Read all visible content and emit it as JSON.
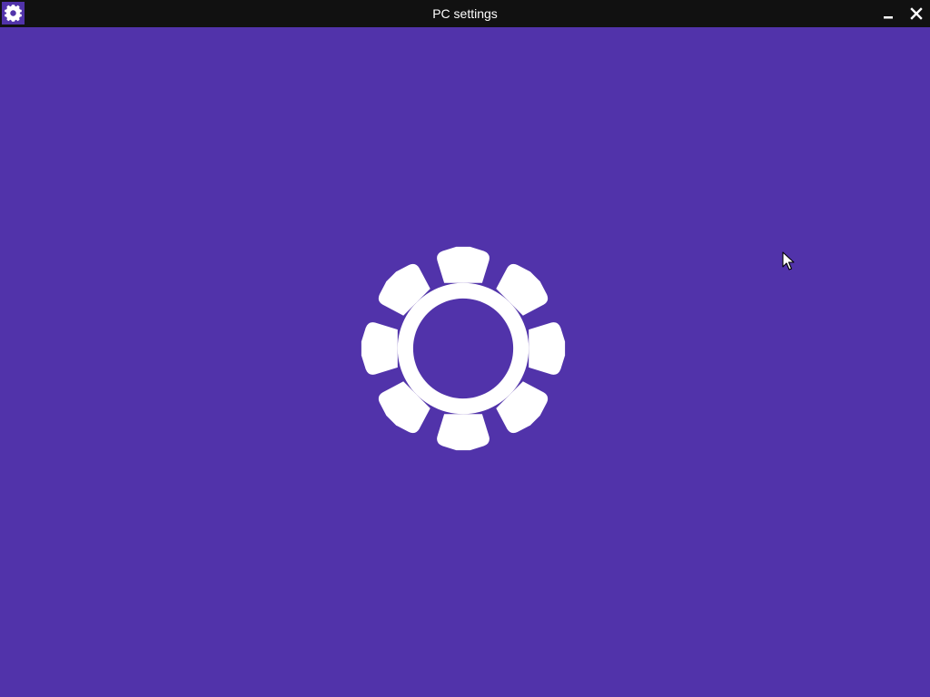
{
  "window": {
    "title": "PC settings",
    "app_icon": "gear-icon",
    "background_color": "#5133aa",
    "titlebar_color": "#111111"
  },
  "controls": {
    "minimize_icon": "minimize-icon",
    "close_icon": "close-icon"
  },
  "splash": {
    "icon": "gear-icon",
    "icon_color": "#ffffff"
  },
  "pointer": {
    "icon": "mouse-cursor-icon"
  }
}
